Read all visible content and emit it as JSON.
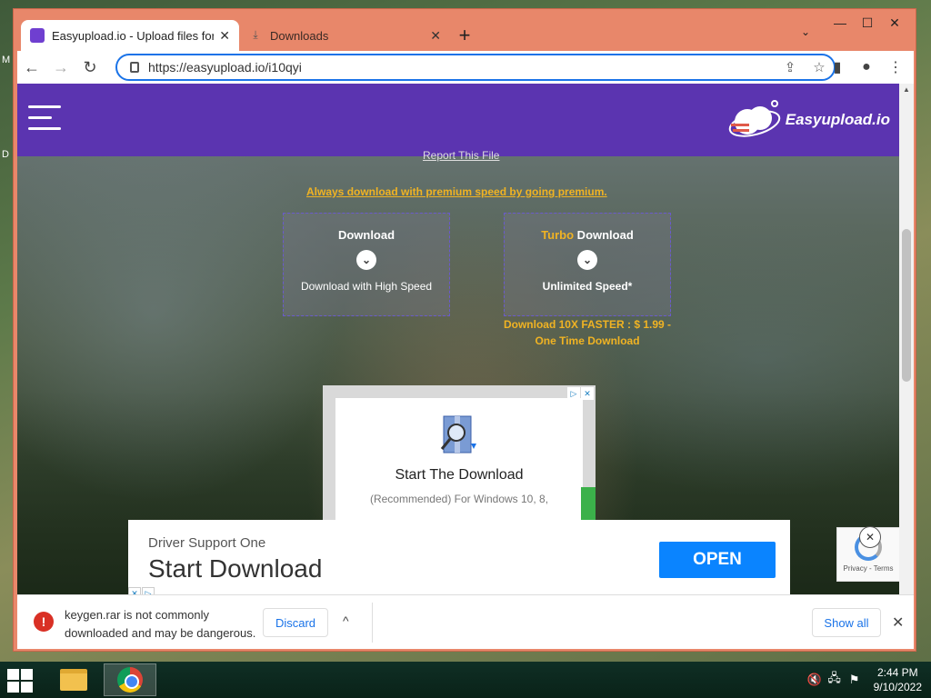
{
  "desktop": {
    "left_char_1": "M",
    "left_char_2": "D"
  },
  "window": {
    "controls": {
      "minimize": "—",
      "maximize": "☐",
      "close": "✕"
    }
  },
  "tabs": [
    {
      "title": "Easyupload.io - Upload files for f",
      "close": "✕"
    },
    {
      "title": "Downloads",
      "close": "✕"
    }
  ],
  "newtab": "+",
  "tab_menu": "⌄",
  "toolbar": {
    "back": "←",
    "forward": "→",
    "reload": "↻",
    "url": "https://easyupload.io/i10qyi",
    "share": "⇪",
    "star": "☆",
    "sidepanel": "▮",
    "profile": "●",
    "menu": "⋮"
  },
  "site": {
    "logo_text": "Easyupload.io",
    "report_link": "Report This File",
    "premium_link": "Always download with premium speed by going premium.",
    "download_box": {
      "title": "Download",
      "subtitle": "Download with High Speed",
      "chevron": "⌄"
    },
    "turbo_box": {
      "title_highlight": "Turbo",
      "title_rest": " Download",
      "subtitle": "Unlimited Speed*",
      "chevron": "⌄"
    },
    "turbo_price": "Download 10X FASTER : $ 1.99 - One Time Download"
  },
  "ad_mid": {
    "adchoice_1": "▷",
    "adchoice_2": "✕",
    "title": "Start The Download",
    "subtitle": "(Recommended) For Windows 10, 8,"
  },
  "ad_bottom": {
    "sponsor": "Driver Support One",
    "headline": "Start Download",
    "cta": "OPEN",
    "adchoice_1": "✕",
    "adchoice_2": "▷"
  },
  "recaptcha": {
    "text": "Privacy - Terms",
    "close": "✕"
  },
  "download_bar": {
    "warn_icon": "!",
    "message": "keygen.rar is not commonly downloaded and may be dangerous.",
    "discard": "Discard",
    "caret": "^",
    "show_all": "Show all",
    "close": "✕"
  },
  "taskbar": {
    "time": "2:44 PM",
    "date": "9/10/2022",
    "tray_icons": [
      "🔇",
      "🖧",
      "⚑"
    ]
  }
}
